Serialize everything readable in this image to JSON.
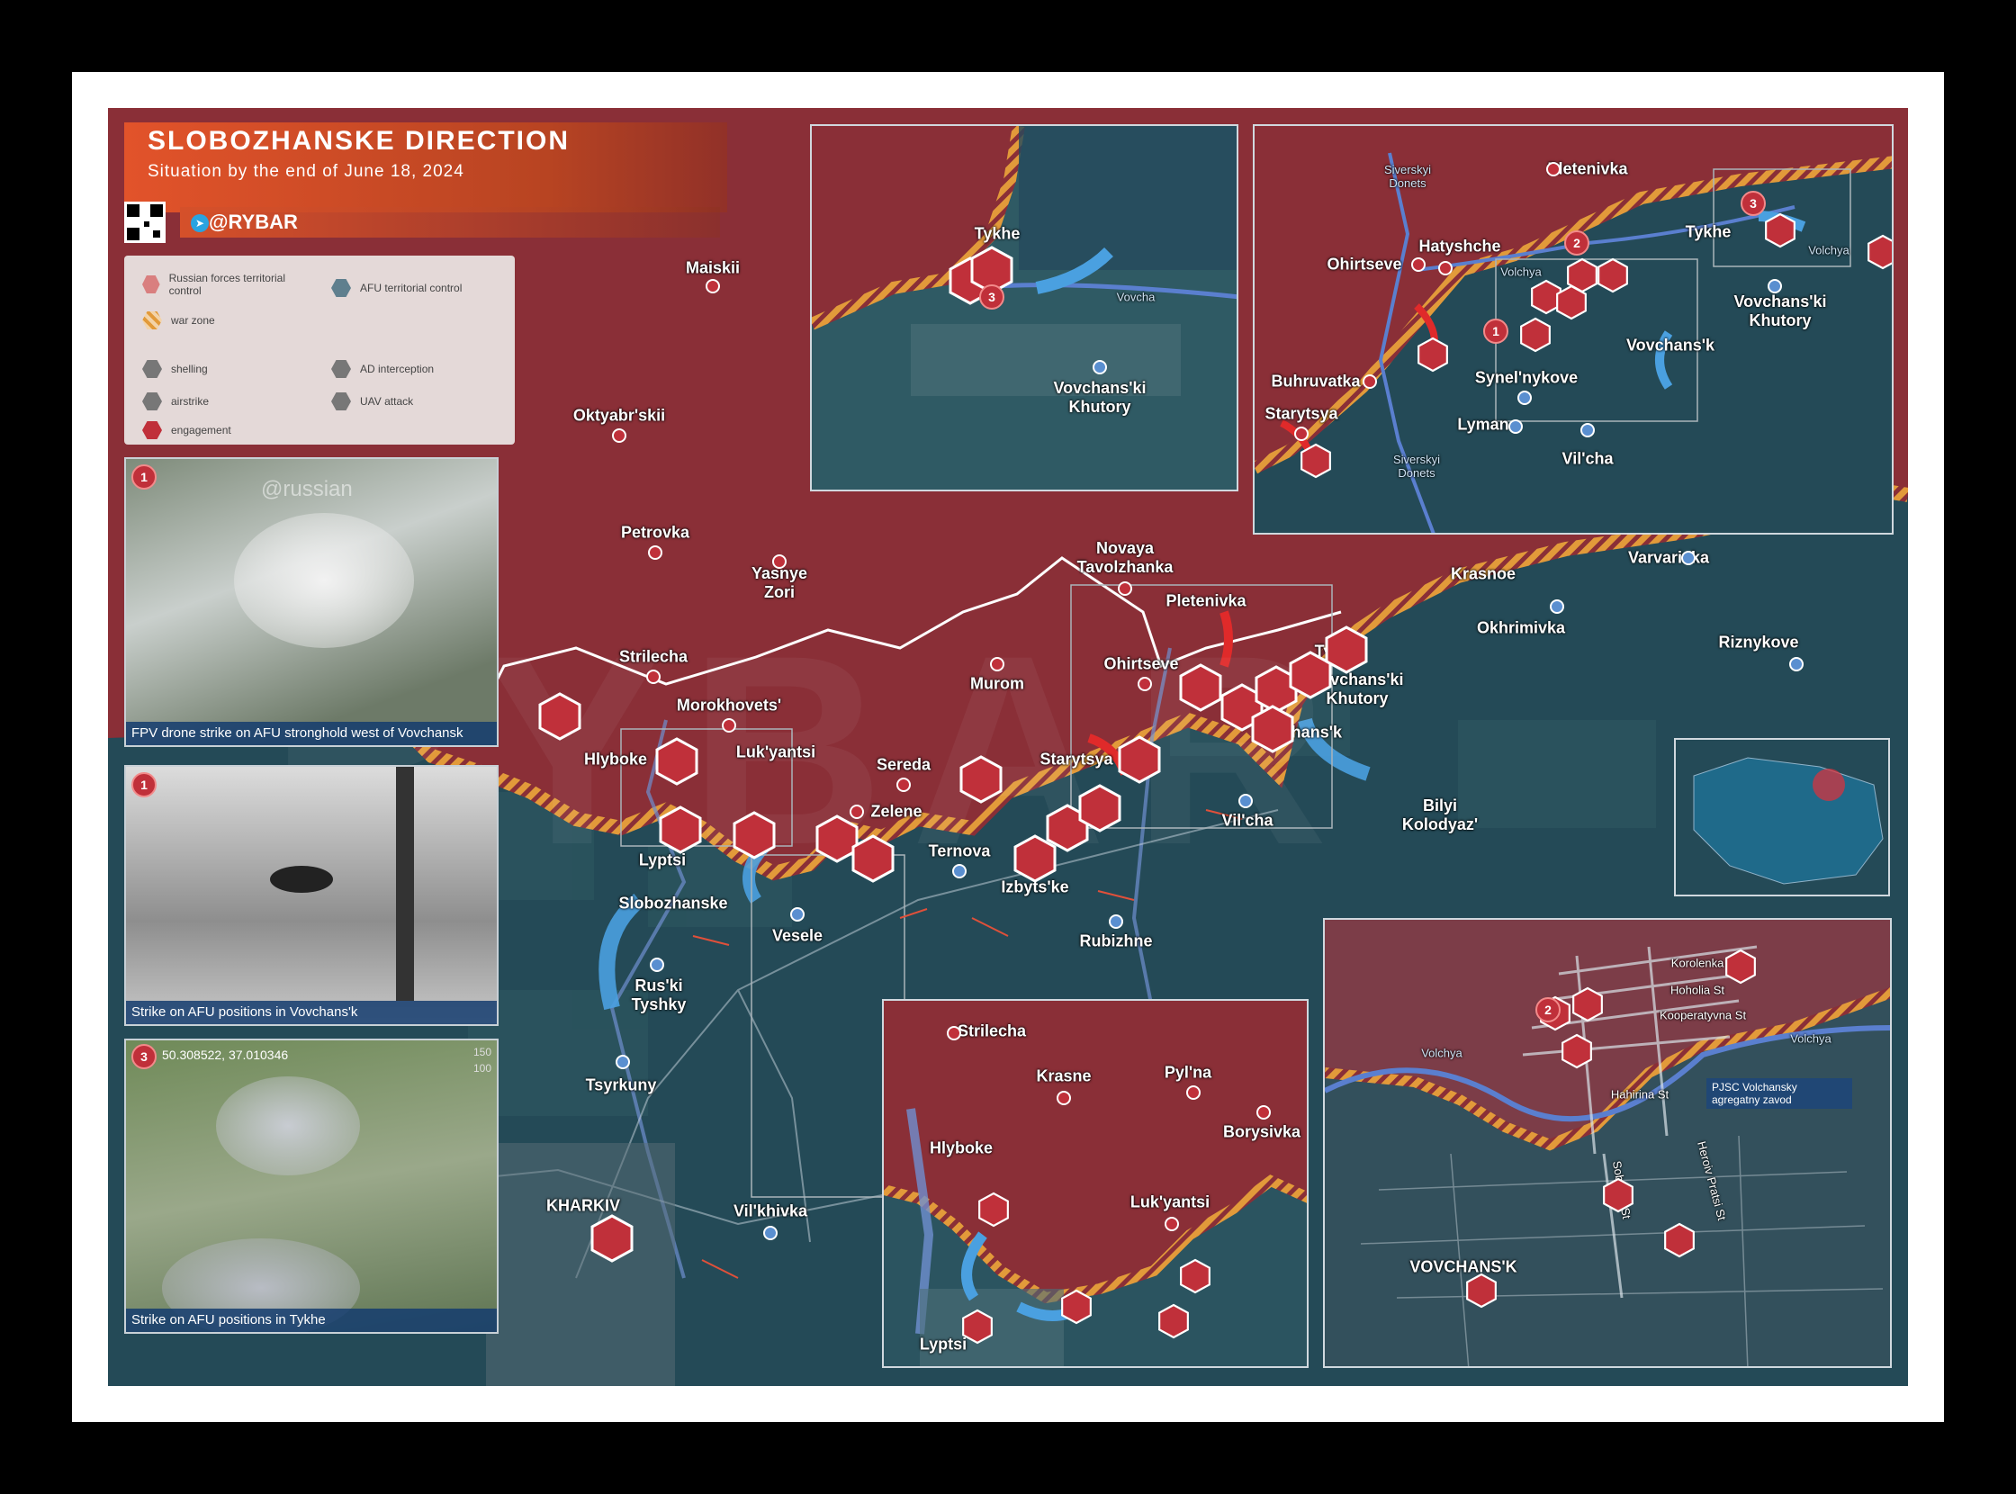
{
  "header": {
    "title": "SLOBOZHANSKE DIRECTION",
    "subtitle": "Situation by the end of June 18, 2024",
    "channel": "@RYBAR"
  },
  "watermark": "RYBAR",
  "legend": {
    "russian_control": "Russian forces territorial control",
    "afu_control": "AFU territorial control",
    "war_zone": "war zone",
    "shelling": "shelling",
    "ad_interception": "AD interception",
    "airstrike": "airstrike",
    "uav_attack": "UAV attack",
    "engagement": "engagement"
  },
  "colors": {
    "russian": "#8a2f37",
    "afu": "#244a57",
    "war_zone": "#e29a3a",
    "marker": "#c0303a",
    "afu_marker": "#3b7fd0"
  },
  "photos": [
    {
      "num": "1",
      "caption": "FPV drone strike on AFU stronghold west of Vovchansk",
      "overlay": "@russian"
    },
    {
      "num": "1",
      "caption": "Strike on AFU positions in Vovchans'k"
    },
    {
      "num": "3",
      "caption": "Strike on AFU positions in Tykhe",
      "coord": "50.308522, 37.010346",
      "scale_top": "150",
      "scale_bottom": "100"
    }
  ],
  "places": {
    "maiskii": "Maiskii",
    "oktyabrskii": "Oktyabr'skii",
    "petrovka": "Petrovka",
    "yasnye_zori": "Yasnye Zori",
    "strilecha": "Strilecha",
    "morokhovets": "Morokhovets'",
    "hlyboke": "Hlyboke",
    "lukyantsi": "Luk'yantsi",
    "lyptsi": "Lyptsi",
    "slobozhanske": "Slobozhanske",
    "ruski_tyshky": "Rus'ki Tyshky",
    "tsyrkuny": "Tsyrkuny",
    "kharkiv": "KHARKIV",
    "vilkhivka": "Vil'khivka",
    "sereda": "Sereda",
    "zelene": "Zelene",
    "ternova": "Ternova",
    "vesele": "Vesele",
    "murom": "Murom",
    "starytsya": "Starytsya",
    "izbytske": "Izbyts'ke",
    "rubizhne": "Rubizhne",
    "novaya_tavolzhanka": "Novaya Tavolzhanka",
    "pletenivka": "Pletenivka",
    "ohirtseve": "Ohirtseve",
    "tykhe": "Tykhe",
    "vovchanski_khutory": "Vovchans'ki Khutory",
    "vovchansk": "Vovchans'k",
    "vilcha": "Vil'cha",
    "bilyi_kolodyaz": "Bilyi Kolodyaz'",
    "krasnoe": "Krasnoe",
    "okhrimivka": "Okhrimivka",
    "varvarivka": "Varvarivka",
    "riznykove": "Riznykove"
  },
  "inset_tykhe": {
    "tykhe": "Tykhe",
    "vovchanski_khutory": "Vovchans'ki Khutory",
    "river": "Vovcha"
  },
  "inset_ne": {
    "pletenivka": "Pletenivka",
    "siverskyi_donets_top": "Siverskyi Donets",
    "hatyshche": "Hatyshche",
    "ohirtseve": "Ohirtseve",
    "volchya": "Volchya",
    "tykhe": "Tykhe",
    "volchya_right": "Volchya",
    "vovchanski_khutory": "Vovchans'ki Khutory",
    "buhruvatka": "Buhruvatka",
    "synelnykove": "Synel'nykove",
    "vovchansk": "Vovchans'k",
    "starytsya": "Starytsya",
    "lyman": "Lyman",
    "siverskyi_donets_bottom": "Siverskyi Donets",
    "vilcha": "Vil'cha"
  },
  "inset_strilecha": {
    "strilecha": "Strilecha",
    "krasne": "Krasne",
    "pylna": "Pyl'na",
    "borysivka": "Borysivka",
    "hlyboke": "Hlyboke",
    "lukyantsi": "Luk'yantsi",
    "lyptsi": "Lyptsi"
  },
  "inset_city": {
    "korolenka": "Korolenka St",
    "hoholia": "Hoholia St",
    "kooperatyvna": "Kooperatyvna St",
    "volchya_left": "Volchya",
    "volchya_right": "Volchya",
    "pjsc": "PJSC Volchansky agregatny zavod",
    "hahirina": "Hahirina St",
    "soborna": "Soborna St",
    "heroiv": "Heroiv Pratsi St",
    "vovchansk": "VOVCHANS'K"
  }
}
